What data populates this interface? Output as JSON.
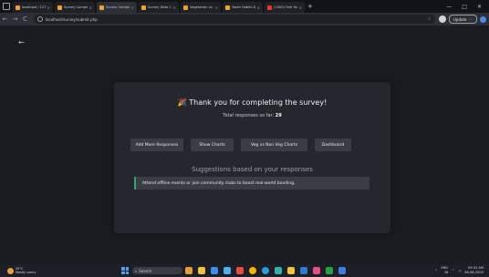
{
  "browser": {
    "tabs": [
      {
        "title": "localhost / 127.0.0.1 /",
        "favicon_color": "#f29b38",
        "active": false
      },
      {
        "title": "Survey Completed",
        "favicon_color": "#f0a12e",
        "active": false
      },
      {
        "title": "Survey Completed",
        "favicon_color": "#f0a12e",
        "active": true
      },
      {
        "title": "Survey Data Charts",
        "favicon_color": "#f0a12e",
        "active": false
      },
      {
        "title": "Vegetarian vs Non-Ve",
        "favicon_color": "#f0a12e",
        "active": false
      },
      {
        "title": "Youth Habits Dashbo",
        "favicon_color": "#f0a12e",
        "active": false
      },
      {
        "title": "(1000) Feel Your Cl",
        "favicon_color": "#e53935",
        "active": false
      }
    ],
    "new_tab": "+",
    "window_controls": {
      "minimize": "—",
      "maximize": "□",
      "close": "✕"
    },
    "nav": {
      "back": "←",
      "forward": "→",
      "reload": "C"
    },
    "url": "localhost/survey/submit.php",
    "update_label": "Update",
    "ellipsis": "⋯"
  },
  "page": {
    "back_arrow": "←",
    "thanks_emoji": "🎉",
    "thanks_title": "Thank you for completing the survey!",
    "total_prefix": "Total responses so far: ",
    "total_count": "29",
    "buttons": [
      "Add More Responses",
      "Show Charts",
      "Veg vs Non Veg Charts",
      "Dashboard"
    ],
    "suggestions_heading": "Suggestions based on your responses",
    "suggestion": "Attend offline events or join community clubs to boost real-world bonding.",
    "accent_color": "#2fa866"
  },
  "taskbar": {
    "weather_temp": "29°C",
    "weather_desc": "Mostly sunny",
    "search_placeholder": "Search",
    "lang_top": "ENG",
    "lang_bottom": "IN",
    "time": "09:33 AM",
    "date": "06-08-2025"
  }
}
